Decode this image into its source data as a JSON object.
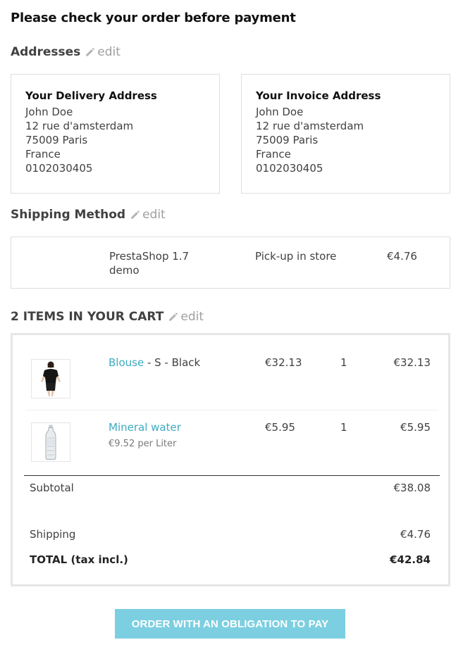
{
  "page_title": "Please check your order before payment",
  "edit_label": "edit",
  "addresses": {
    "heading": "Addresses",
    "delivery": {
      "title": "Your Delivery Address",
      "lines": [
        "John Doe",
        "12 rue d'amsterdam",
        "75009 Paris",
        "France",
        "0102030405"
      ]
    },
    "invoice": {
      "title": "Your Invoice Address",
      "lines": [
        "John Doe",
        "12 rue d'amsterdam",
        "75009 Paris",
        "France",
        "0102030405"
      ]
    }
  },
  "shipping_method": {
    "heading": "Shipping Method",
    "carrier_line1": "PrestaShop 1.7",
    "carrier_line2": "demo",
    "delay": "Pick-up in store",
    "price": "€4.76"
  },
  "cart": {
    "heading": "2 ITEMS IN YOUR CART",
    "items": [
      {
        "name": "Blouse",
        "attributes": " - S - Black",
        "unit_price": "€32.13",
        "quantity": "1",
        "total": "€32.13",
        "image_icon": "blouse-product-thumbnail"
      },
      {
        "name": "Mineral water",
        "attributes": "",
        "unit_note": "€9.52 per Liter",
        "unit_price": "€5.95",
        "quantity": "1",
        "total": "€5.95",
        "image_icon": "water-bottle-thumbnail"
      }
    ],
    "subtotal_label": "Subtotal",
    "subtotal_value": "€38.08",
    "shipping_label": "Shipping",
    "shipping_value": "€4.76",
    "total_label": "TOTAL (tax incl.)",
    "total_value": "€42.84"
  },
  "order_button": "ORDER WITH AN OBLIGATION TO PAY",
  "colors": {
    "link": "#3cabc2",
    "button": "#7ccfe0",
    "muted": "#a0a0a0"
  }
}
